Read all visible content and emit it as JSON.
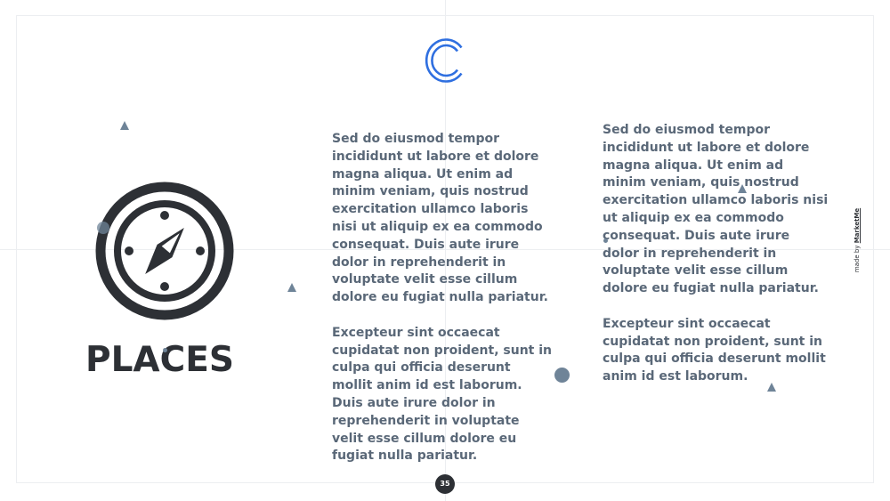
{
  "slide": {
    "title": "PLACES",
    "page_number": "35",
    "credit_prefix": "made by ",
    "credit_brand": "MarketMe",
    "logo_icon": "double-c-logo-icon",
    "main_icon": "compass-icon",
    "accent_color": "#2f6fe0",
    "text_color": "#5a6878",
    "dark_color": "#2d3035",
    "shape_color": "#6f8498"
  },
  "column1": {
    "paragraph1": "Sed do eiusmod tempor incididunt ut labore et dolore magna aliqua. Ut enim ad minim veniam, quis nostrud exercitation ullamco laboris nisi ut aliquip ex ea commodo consequat. Duis aute irure dolor in reprehenderit in voluptate velit esse cillum dolore eu fugiat nulla pariatur.",
    "paragraph2": "Excepteur sint occaecat cupidatat non proident, sunt in culpa qui officia deserunt mollit anim id est laborum.",
    "paragraph3": "Duis aute irure dolor in reprehenderit in voluptate velit esse cillum dolore eu fugiat nulla pariatur."
  },
  "column2": {
    "paragraph1": "Sed do eiusmod tempor incididunt ut labore et dolore magna aliqua. Ut enim ad minim veniam, quis nostrud exercitation ullamco laboris nisi ut aliquip ex ea commodo consequat. Duis aute irure dolor in reprehenderit in voluptate velit esse cillum dolore eu fugiat nulla pariatur.",
    "paragraph2": "Excepteur sint occaecat cupidatat non proident, sunt in culpa qui officia deserunt mollit anim id est laborum."
  }
}
